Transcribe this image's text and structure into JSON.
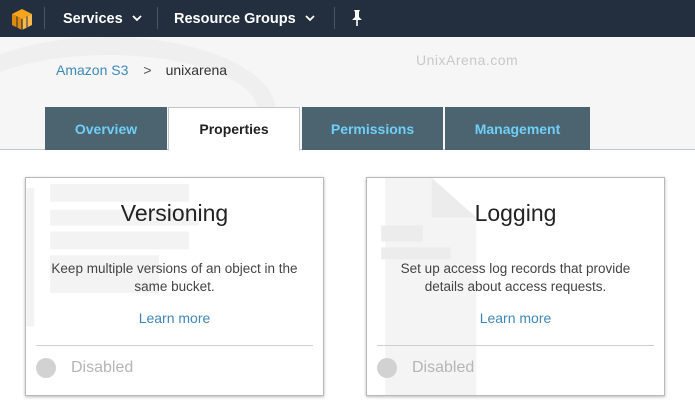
{
  "topbar": {
    "logo_icon": "aws-cube-icon",
    "services_label": "Services",
    "resource_groups_label": "Resource Groups",
    "pin_icon": "pin-icon"
  },
  "watermark": "UnixArena.com",
  "breadcrumb": {
    "parent": "Amazon S3",
    "separator": ">",
    "current": "unixarena"
  },
  "tabs": [
    {
      "label": "Overview",
      "active": false
    },
    {
      "label": "Properties",
      "active": true
    },
    {
      "label": "Permissions",
      "active": false
    },
    {
      "label": "Management",
      "active": false
    }
  ],
  "cards": [
    {
      "title": "Versioning",
      "description": "Keep multiple versions of an object in the same bucket.",
      "learn_more": "Learn more",
      "status": "Disabled",
      "icon": "versioning-stack-icon"
    },
    {
      "title": "Logging",
      "description": "Set up access log records that provide details about access requests.",
      "learn_more": "Learn more",
      "status": "Disabled",
      "icon": "logging-document-icon"
    }
  ],
  "colors": {
    "topbar": "#232f3e",
    "tab_inactive_bg": "#4b6470",
    "tab_inactive_text": "#6fcff7",
    "link": "#3e88b8",
    "aws_orange": "#f7a31c"
  }
}
